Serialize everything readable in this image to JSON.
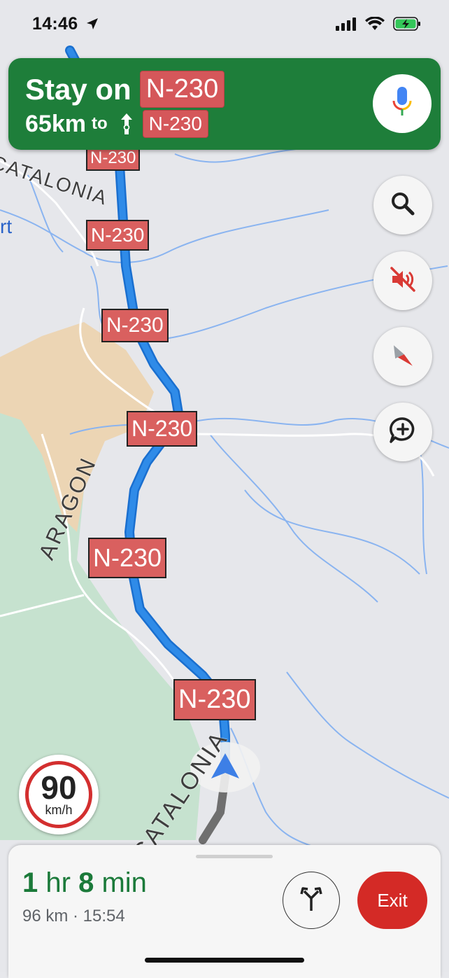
{
  "status_bar": {
    "time": "14:46"
  },
  "nav_banner": {
    "instruction": "Stay on",
    "road": "N-230",
    "distance": "65km",
    "to": "to",
    "next_road": "N-230"
  },
  "map": {
    "road_labels": [
      "N-230",
      "N-230",
      "N-230",
      "N-230",
      "N-230",
      "N-230"
    ],
    "region_labels": [
      "CATALONIA",
      "ARAGON",
      "CATALONIA"
    ],
    "partial_place": "rt"
  },
  "speed_limit": {
    "value": "90",
    "unit": "km/h"
  },
  "trip": {
    "eta_hr": "1",
    "eta_hr_unit": "hr",
    "eta_min": "8",
    "eta_min_unit": "min",
    "summary": "96 km · 15:54",
    "exit_label": "Exit"
  },
  "colors": {
    "banner": "#1e7e3a",
    "route": "#2f8be8",
    "road_label": "#d5575a",
    "exit": "#d42a26",
    "eta": "#1b7a3a"
  }
}
